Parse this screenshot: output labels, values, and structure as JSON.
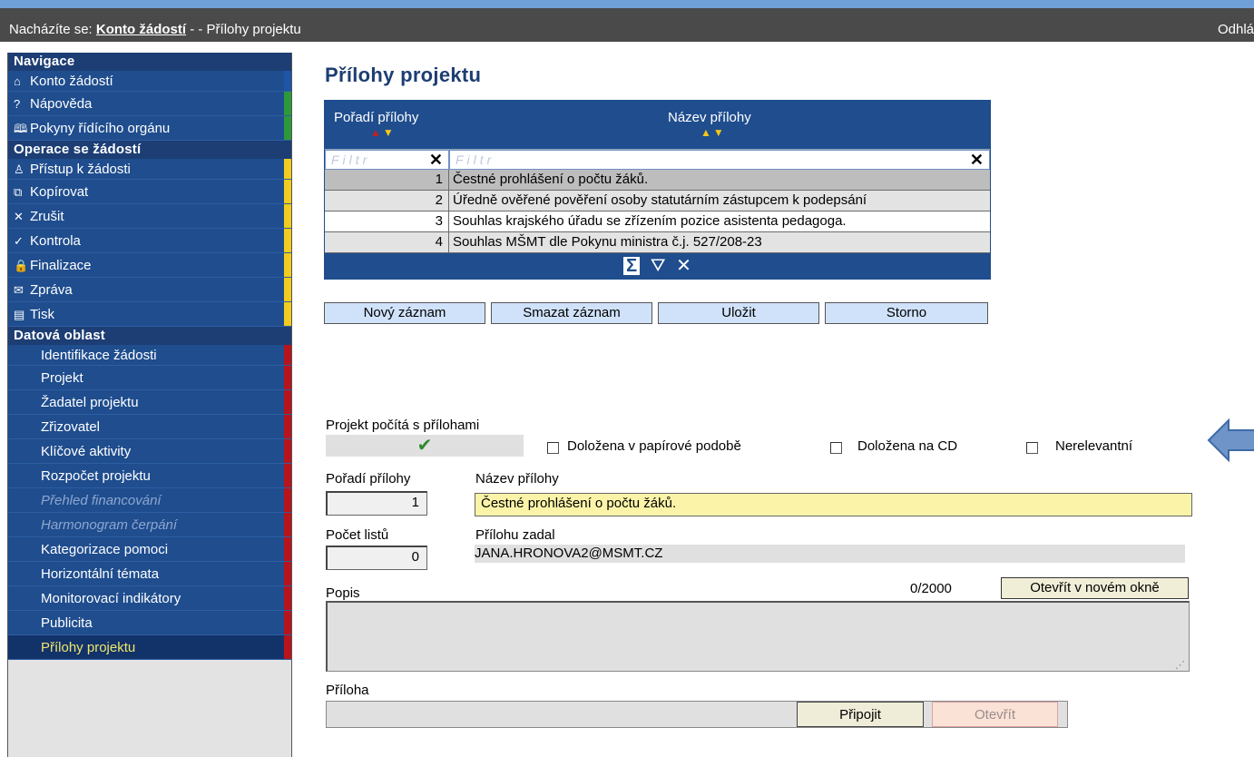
{
  "topbar": {
    "prefix": "Nacházíte se: ",
    "crumb_link": "Konto žádostí",
    "crumb_rest": " - - Přílohy projektu",
    "logout": "Odhlá"
  },
  "sidebar": {
    "nav_title": "Navigace",
    "nav_items": [
      {
        "icon": "⌂",
        "label": "Konto žádostí"
      },
      {
        "icon": "?",
        "label": "Nápověda"
      },
      {
        "icon": "🕮",
        "label": "Pokyny řídícího orgánu"
      }
    ],
    "ops_title": "Operace se žádostí",
    "ops_items": [
      {
        "icon": "♙",
        "label": "Přístup k žádosti"
      },
      {
        "icon": "⧉",
        "label": "Kopírovat"
      },
      {
        "icon": "✕",
        "label": "Zrušit"
      },
      {
        "icon": "✓",
        "label": "Kontrola"
      },
      {
        "icon": "🔒",
        "label": "Finalizace"
      },
      {
        "icon": "✉",
        "label": "Zpráva"
      },
      {
        "icon": "▤",
        "label": "Tisk"
      }
    ],
    "data_title": "Datová oblast",
    "data_items": [
      {
        "label": "Identifikace žádosti"
      },
      {
        "label": "Projekt"
      },
      {
        "label": "Žadatel projektu"
      },
      {
        "label": "Zřizovatel"
      },
      {
        "label": "Klíčové aktivity"
      },
      {
        "label": "Rozpočet projektu"
      },
      {
        "label": "Přehled financování"
      },
      {
        "label": "Harmonogram čerpání"
      },
      {
        "label": "Kategorizace pomoci"
      },
      {
        "label": "Horizontální témata"
      },
      {
        "label": "Monitorovací indikátory"
      },
      {
        "label": "Publicita"
      },
      {
        "label": "Přílohy projektu"
      }
    ]
  },
  "main": {
    "title": "Přílohy projektu",
    "grid": {
      "col1_header": "Pořadí přílohy",
      "col2_header": "Název přílohy",
      "filter_placeholder": "Filtr",
      "rows": [
        {
          "no": "1",
          "name": "Čestné prohlášení o počtu žáků."
        },
        {
          "no": "2",
          "name": "Úředně ověřené pověření osoby statutárním zástupcem k podepsání"
        },
        {
          "no": "3",
          "name": "Souhlas krajského úřadu se zřízením pozice asistenta pedagoga."
        },
        {
          "no": "4",
          "name": "Souhlas MŠMT dle Pokynu ministra č.j. 527/208-23"
        }
      ]
    },
    "buttons": {
      "new": "Nový záznam",
      "delete": "Smazat záznam",
      "save": "Uložit",
      "cancel": "Storno"
    },
    "form": {
      "project_counts_label": "Projekt počítá s přílohami",
      "paper_label": "Doložena v papírové podobě",
      "cd_label": "Doložena na CD",
      "irrelevant_label": "Nerelevantní",
      "order_label": "Pořadí přílohy",
      "order_value": "1",
      "name_label": "Název přílohy",
      "name_value": "Čestné prohlášení o počtu žáků.",
      "sheets_label": "Počet listů",
      "sheets_value": "0",
      "entered_by_label": "Přílohu zadal",
      "entered_by_value": "JANA.HRONOVA2@MSMT.CZ",
      "desc_label": "Popis",
      "desc_counter": "0/2000",
      "open_new_window": "Otevřít v novém okně",
      "attachment_label": "Příloha",
      "attach_button": "Připojit",
      "open_button": "Otevřít"
    }
  }
}
